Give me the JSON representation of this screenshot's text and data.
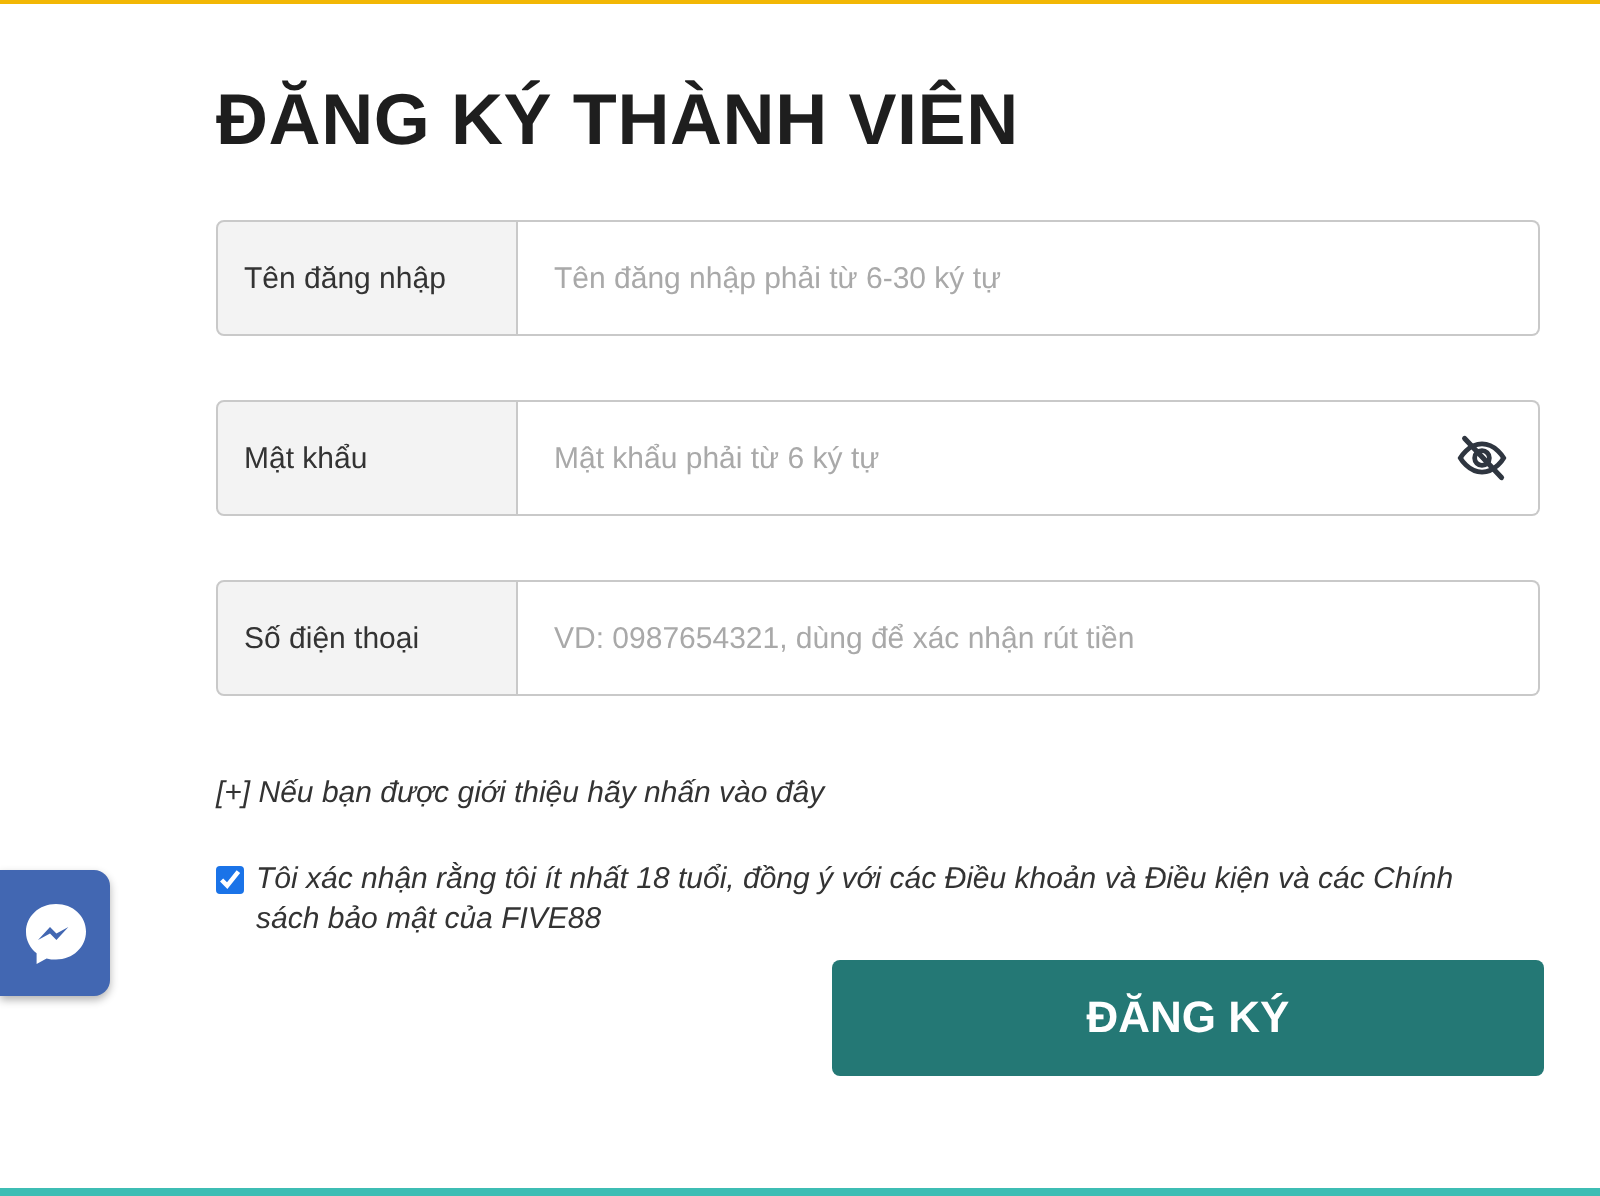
{
  "title": "ĐĂNG KÝ THÀNH VIÊN",
  "fields": [
    {
      "kind": "text",
      "label": "Tên đăng nhập",
      "placeholder": "Tên đăng nhập phải từ 6-30 ký tự"
    },
    {
      "kind": "password",
      "label": "Mật khẩu",
      "placeholder": "Mật khẩu phải từ 6 ký tự"
    },
    {
      "kind": "text",
      "label": "Số điện thoại",
      "placeholder": "VD: 0987654321, dùng để xác nhận rút tiền"
    }
  ],
  "referral_link": "[+] Nếu bạn được giới thiệu hãy nhấn vào đây",
  "agreement": {
    "checked": true,
    "text": "Tôi xác nhận rằng tôi ít nhất 18 tuổi, đồng ý với các Điều khoản và Điều kiện và các Chính sách bảo mật của FIVE88"
  },
  "submit_button": "ĐĂNG KÝ"
}
